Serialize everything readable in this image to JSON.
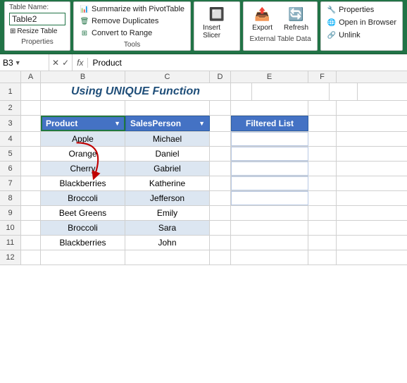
{
  "ribbon": {
    "table_name_label": "Table Name:",
    "table_name_value": "Table2",
    "resize_label": "Resize Table",
    "properties_label": "Properties",
    "summarize_label": "Summarize with PivotTable",
    "remove_duplicates_label": "Remove Duplicates",
    "convert_range_label": "Convert to Range",
    "tools_label": "Tools",
    "insert_slicer_label": "Insert Slicer",
    "export_label": "Export",
    "refresh_label": "Refresh",
    "properties2_label": "Properties",
    "open_browser_label": "Open in Browser",
    "unlink_label": "Unlink",
    "external_data_label": "External Table Data"
  },
  "formula_bar": {
    "name_box": "B3",
    "fx": "fx",
    "formula": "Product"
  },
  "sheet": {
    "title": "Using UNIQUE Function",
    "col_headers": [
      "",
      "A",
      "B",
      "C",
      "D",
      "E",
      "F"
    ],
    "rows": [
      {
        "num": "1",
        "a": "",
        "b": "",
        "c": "",
        "d": "",
        "e": "",
        "f": ""
      },
      {
        "num": "2",
        "a": "",
        "b": "",
        "c": "",
        "d": "",
        "e": "",
        "f": ""
      },
      {
        "num": "3",
        "a": "",
        "b": "Product",
        "c": "SalesPerson",
        "d": "",
        "e": "Filtered List",
        "f": ""
      },
      {
        "num": "4",
        "a": "",
        "b": "Apple",
        "c": "Michael",
        "d": "",
        "e": "",
        "f": ""
      },
      {
        "num": "5",
        "a": "",
        "b": "Orange",
        "c": "Daniel",
        "d": "",
        "e": "",
        "f": ""
      },
      {
        "num": "6",
        "a": "",
        "b": "Cherry",
        "c": "Gabriel",
        "d": "",
        "e": "",
        "f": ""
      },
      {
        "num": "7",
        "a": "",
        "b": "Blackberries",
        "c": "Katherine",
        "d": "",
        "e": "",
        "f": ""
      },
      {
        "num": "8",
        "a": "",
        "b": "Broccoli",
        "c": "Jefferson",
        "d": "",
        "e": "",
        "f": ""
      },
      {
        "num": "9",
        "a": "",
        "b": "Beet Greens",
        "c": "Emily",
        "d": "",
        "e": "",
        "f": ""
      },
      {
        "num": "10",
        "a": "",
        "b": "Broccoli",
        "c": "Sara",
        "d": "",
        "e": "",
        "f": ""
      },
      {
        "num": "11",
        "a": "",
        "b": "Blackberries",
        "c": "John",
        "d": "",
        "e": "",
        "f": ""
      },
      {
        "num": "12",
        "a": "",
        "b": "",
        "c": "",
        "d": "",
        "e": "",
        "f": ""
      }
    ]
  }
}
